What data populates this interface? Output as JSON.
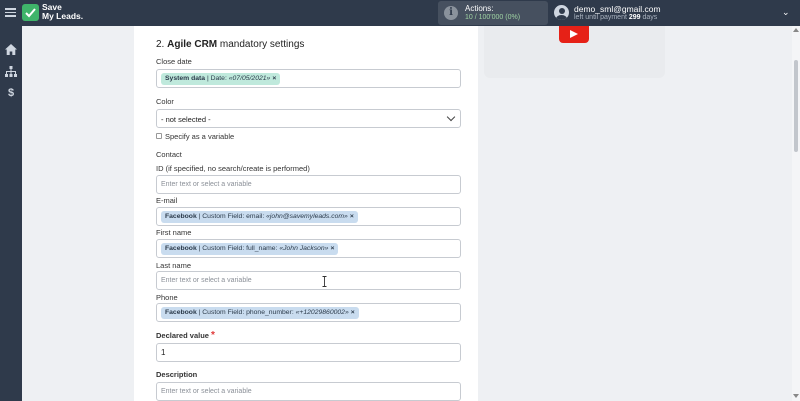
{
  "header": {
    "logo_line1": "Save",
    "logo_line2": "My Leads.",
    "actions_label": "Actions:",
    "actions_count": "10 / 100'000",
    "actions_percent": "(0%)",
    "user_email": "demo_sml@gmail.com",
    "payment_prefix": "left until payment",
    "payment_days": "299",
    "payment_suffix": "days"
  },
  "sidebar": {
    "icons": [
      "home-icon",
      "sitemap-icon",
      "dollar-icon"
    ]
  },
  "form": {
    "section_number": "2.",
    "section_app": "Agile CRM",
    "section_rest": "mandatory settings",
    "close_date": {
      "label": "Close date",
      "tag_source": "System data",
      "tag_field": "| Date:",
      "tag_value": "«07/05/2021»"
    },
    "color": {
      "label": "Color",
      "selected": "- not selected -",
      "variable_label": "Specify as a variable"
    },
    "contact_label": "Contact",
    "id_field": {
      "label": "ID (if specified, no search/create is performed)",
      "placeholder": "Enter text or select a variable"
    },
    "email": {
      "label": "E-mail",
      "tag_source": "Facebook",
      "tag_field": "| Custom Field: email:",
      "tag_value": "«john@savemyleads.com»"
    },
    "first_name": {
      "label": "First name",
      "tag_source": "Facebook",
      "tag_field": "| Custom Field: full_name:",
      "tag_value": "«John Jackson»"
    },
    "last_name": {
      "label": "Last name",
      "placeholder": "Enter text or select a variable"
    },
    "phone": {
      "label": "Phone",
      "tag_source": "Facebook",
      "tag_field": "| Custom Field: phone_number:",
      "tag_value": "«+12029860002»"
    },
    "declared_value": {
      "label": "Declared value",
      "required_mark": "*",
      "value": "1"
    },
    "description": {
      "label": "Description",
      "placeholder": "Enter text or select a variable"
    },
    "remove_symbol": "×"
  },
  "colors": {
    "topbar": "#2f3a4b",
    "tag_blue": "#c9dcef",
    "tag_green": "#bfe9dc",
    "youtube": "#e62117",
    "brand_green": "#3fb46a"
  }
}
